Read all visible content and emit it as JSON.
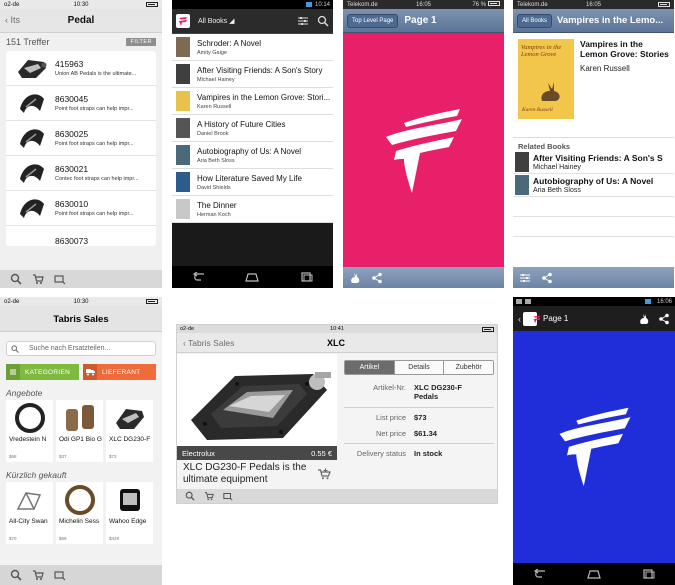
{
  "pedal": {
    "status": {
      "carrier": "o2-de",
      "time": "10:30"
    },
    "back": "Its",
    "title": "Pedal",
    "count": "151 Treffer",
    "filter": "FILTER",
    "items": [
      {
        "id": "415963",
        "desc": "Union AB Pedals is the ultimate..."
      },
      {
        "id": "8630045",
        "desc": "Point foot straps can help impr..."
      },
      {
        "id": "8630025",
        "desc": "Point foot straps can help impr..."
      },
      {
        "id": "8630021",
        "desc": "Contec foot straps can help impr..."
      },
      {
        "id": "8630010",
        "desc": "Point foot straps can help impr..."
      },
      {
        "id": "8630073",
        "desc": ""
      }
    ]
  },
  "books": {
    "status": {
      "time": "10:14"
    },
    "selector": "All Books",
    "items": [
      {
        "title": "Schroder: A Novel",
        "author": "Amity Gaige",
        "color": "#7d6a52"
      },
      {
        "title": "After Visiting Friends: A Son's Story",
        "author": "Michael Hainey",
        "color": "#3f3f3f"
      },
      {
        "title": "Vampires in the Lemon Grove: Stori...",
        "author": "Karen Russell",
        "color": "#e8c24a"
      },
      {
        "title": "A History of Future Cities",
        "author": "Daniel Brook",
        "color": "#555555"
      },
      {
        "title": "Autobiography of Us: A Novel",
        "author": "Aria Beth Sloss",
        "color": "#4a6a7a"
      },
      {
        "title": "How Literature Saved My Life",
        "author": "David Shields",
        "color": "#2d5c8c"
      },
      {
        "title": "The Dinner",
        "author": "Herman Koch",
        "color": "#c8c8c8"
      }
    ]
  },
  "pink": {
    "status": {
      "carrier": "Telekom.de",
      "time": "16:05",
      "battery": "76 %"
    },
    "back": "Top Level Page",
    "title": "Page 1",
    "bg": "#e8206a"
  },
  "vampires": {
    "status": {
      "carrier": "Telekom.de",
      "time": "16:05"
    },
    "back": "All Books",
    "title": "Vampires in the Lemo...",
    "book_title": "Vampires in the Lemon Grove: Stories",
    "author": "Karen Russell",
    "cover_title": "Vampires in the Lemon Grove",
    "cover_author": "Karen Russell",
    "related_header": "Related Books",
    "related": [
      {
        "title": "After Visiting Friends: A Son's S",
        "author": "Michael Hainey"
      },
      {
        "title": "Autobiography of Us: A Novel",
        "author": "Aria Beth Sloss"
      }
    ]
  },
  "tabris": {
    "status": {
      "carrier": "o2-de",
      "time": "10:30"
    },
    "title": "Tabris Sales",
    "search_placeholder": "Suche nach Ersatzteilen...",
    "kategorien": "KATEGORIEN",
    "lieferant": "LIEFERANT",
    "offers_title": "Angebote",
    "offers": [
      {
        "name": "Vredestein N",
        "price": "$68"
      },
      {
        "name": "Odi GP1 Bio G",
        "price": "$37"
      },
      {
        "name": "XLC DG230-F",
        "price": "$73"
      }
    ],
    "recent_title": "Kürzlich gekauft",
    "recent": [
      {
        "name": "All-City Swan",
        "price": "$70"
      },
      {
        "name": "Michelin Sess",
        "price": "$69"
      },
      {
        "name": "Wahoo Edge",
        "price": "$429"
      }
    ]
  },
  "xlc": {
    "status": {
      "carrier": "o2-de",
      "time": "10:41"
    },
    "back": "Tabris Sales",
    "title": "XLC",
    "brand": "Electrolux",
    "price_tag": "0.55 €",
    "product_title": "XLC DG230-F Pedals is the ultimate equipment",
    "tabs": [
      "Artikel",
      "Details",
      "Zubehör"
    ],
    "article_label": "Artikel-Nr.",
    "article_value": "XLC DG230-F Pedals",
    "list_label": "List price",
    "list_value": "$73",
    "net_label": "Net price",
    "net_value": "$61.34",
    "delivery_label": "Delivery status",
    "delivery_value": "In stock"
  },
  "blue": {
    "status": {
      "time": "16:06"
    },
    "title": "Page 1",
    "bg": "#1f2ed8"
  }
}
